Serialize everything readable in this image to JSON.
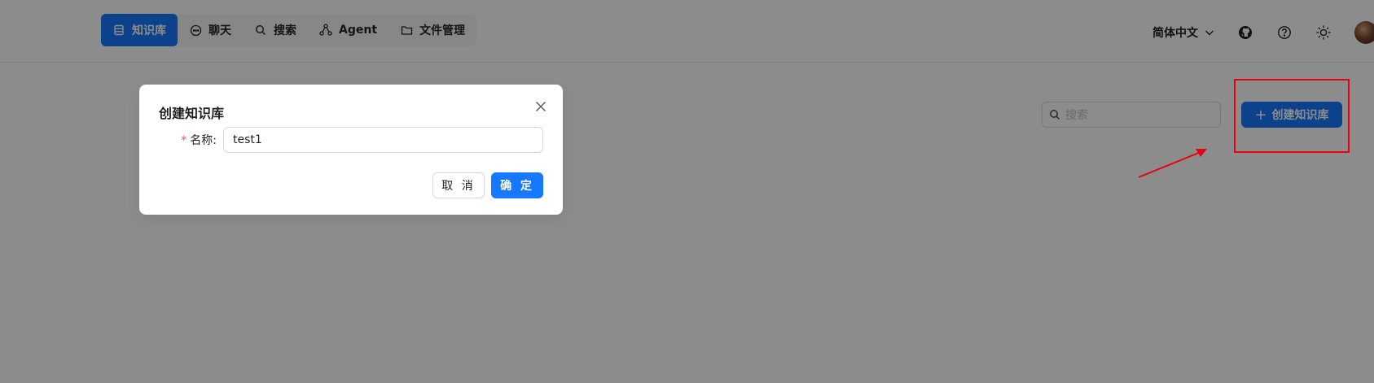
{
  "nav": {
    "items": [
      {
        "label": "知识库",
        "icon": "database-icon",
        "active": true
      },
      {
        "label": "聊天",
        "icon": "chat-icon",
        "active": false
      },
      {
        "label": "搜索",
        "icon": "search-icon",
        "active": false
      },
      {
        "label": "Agent",
        "icon": "agent-graph-icon",
        "active": false
      },
      {
        "label": "文件管理",
        "icon": "folder-icon",
        "active": false
      }
    ]
  },
  "header": {
    "language": "简体中文",
    "tools": [
      "github-icon",
      "help-icon",
      "theme-sun-icon"
    ]
  },
  "toolbar": {
    "search_placeholder": "搜索",
    "create_label": "创建知识库"
  },
  "modal": {
    "title": "创建知识库",
    "field_label": "名称:",
    "field_value": "test1",
    "cancel_label": "取 消",
    "ok_label": "确 定"
  },
  "colors": {
    "primary": "#1677ff",
    "annotation": "#e60012",
    "overlay": "rgba(0,0,0,0.45)"
  }
}
